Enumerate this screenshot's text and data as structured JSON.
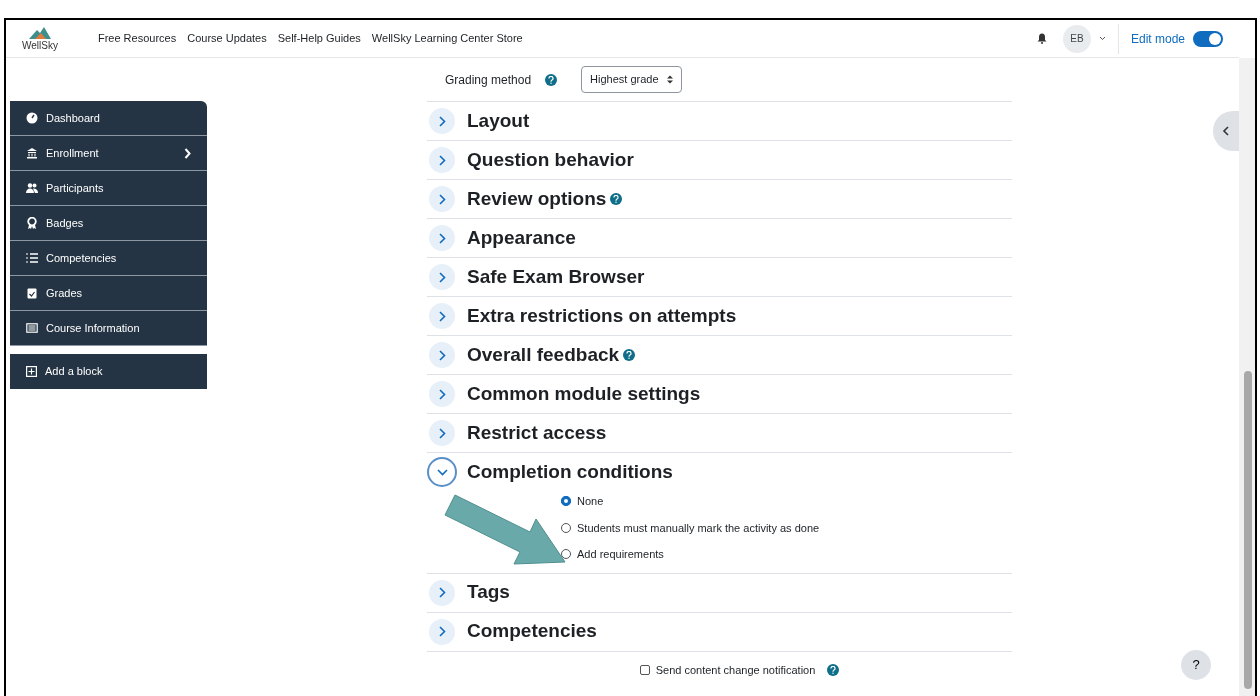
{
  "navbar": {
    "logo_text": "WellSky",
    "links": [
      "Free Resources",
      "Course Updates",
      "Self-Help Guides",
      "WellSky Learning Center Store"
    ],
    "user_initials": "EB",
    "edit_mode": {
      "label": "Edit mode",
      "on": true
    }
  },
  "sidebar": {
    "items": [
      {
        "label": "Dashboard",
        "has_submenu": false
      },
      {
        "label": "Enrollment",
        "has_submenu": true
      },
      {
        "label": "Participants",
        "has_submenu": false
      },
      {
        "label": "Badges",
        "has_submenu": false
      },
      {
        "label": "Competencies",
        "has_submenu": false
      },
      {
        "label": "Grades",
        "has_submenu": false
      },
      {
        "label": "Course Information",
        "has_submenu": false
      }
    ],
    "add_block": "Add a block"
  },
  "grading": {
    "label": "Grading method",
    "help": true,
    "value": "Highest grade"
  },
  "sections": [
    {
      "title": "Layout",
      "expanded": false,
      "help": false
    },
    {
      "title": "Question behavior",
      "expanded": false,
      "help": false
    },
    {
      "title": "Review options",
      "expanded": false,
      "help": true
    },
    {
      "title": "Appearance",
      "expanded": false,
      "help": false
    },
    {
      "title": "Safe Exam Browser",
      "expanded": false,
      "help": false
    },
    {
      "title": "Extra restrictions on attempts",
      "expanded": false,
      "help": false
    },
    {
      "title": "Overall feedback",
      "expanded": false,
      "help": true
    },
    {
      "title": "Common module settings",
      "expanded": false,
      "help": false
    },
    {
      "title": "Restrict access",
      "expanded": false,
      "help": false
    },
    {
      "title": "Completion conditions",
      "expanded": true,
      "help": false,
      "options": [
        {
          "label": "None",
          "selected": true
        },
        {
          "label": "Students must manually mark the activity as done",
          "selected": false
        },
        {
          "label": "Add requirements",
          "selected": false
        }
      ]
    },
    {
      "title": "Tags",
      "expanded": false,
      "help": false
    },
    {
      "title": "Competencies",
      "expanded": false,
      "help": false
    }
  ],
  "notification": {
    "label": "Send content change notification",
    "checked": false,
    "help": true
  },
  "help_button": "?"
}
